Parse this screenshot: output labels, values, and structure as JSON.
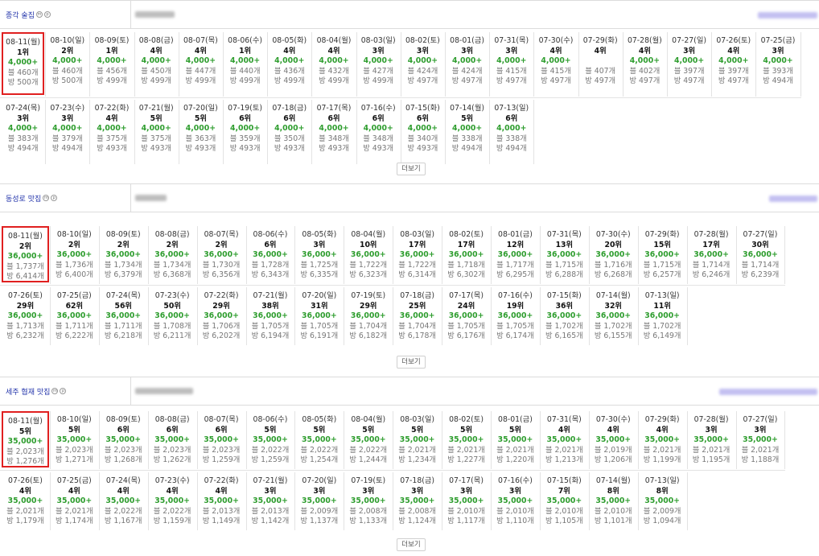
{
  "sections": [
    {
      "keyword": "종각 술집",
      "more_label": "더보기",
      "cols": 18,
      "cells": [
        {
          "d": "08-11(월)",
          "r": "1위",
          "g": "4,000+",
          "a": "블 460개",
          "b": "방 500개",
          "sel": true
        },
        {
          "d": "08-10(일)",
          "r": "2위",
          "g": "4,000+",
          "a": "블 460개",
          "b": "방 500개"
        },
        {
          "d": "08-09(토)",
          "r": "1위",
          "g": "4,000+",
          "a": "블 456개",
          "b": "방 499개"
        },
        {
          "d": "08-08(금)",
          "r": "4위",
          "g": "4,000+",
          "a": "블 450개",
          "b": "방 499개"
        },
        {
          "d": "08-07(목)",
          "r": "4위",
          "g": "4,000+",
          "a": "블 447개",
          "b": "방 499개"
        },
        {
          "d": "08-06(수)",
          "r": "1위",
          "g": "4,000+",
          "a": "블 440개",
          "b": "방 499개"
        },
        {
          "d": "08-05(화)",
          "r": "4위",
          "g": "4,000+",
          "a": "블 436개",
          "b": "방 499개"
        },
        {
          "d": "08-04(월)",
          "r": "4위",
          "g": "4,000+",
          "a": "블 432개",
          "b": "방 499개"
        },
        {
          "d": "08-03(일)",
          "r": "3위",
          "g": "4,000+",
          "a": "블 427개",
          "b": "방 499개"
        },
        {
          "d": "08-02(토)",
          "r": "3위",
          "g": "4,000+",
          "a": "블 424개",
          "b": "방 497개"
        },
        {
          "d": "08-01(금)",
          "r": "3위",
          "g": "4,000+",
          "a": "블 424개",
          "b": "방 497개"
        },
        {
          "d": "07-31(목)",
          "r": "3위",
          "g": "4,000+",
          "a": "블 415개",
          "b": "방 497개"
        },
        {
          "d": "07-30(수)",
          "r": "4위",
          "g": "4,000+",
          "a": "블 415개",
          "b": "방 497개"
        },
        {
          "d": "07-29(화)",
          "r": "4위",
          "g": "",
          "a": "블 407개",
          "b": "방 497개"
        },
        {
          "d": "07-28(월)",
          "r": "4위",
          "g": "4,000+",
          "a": "블 402개",
          "b": "방 497개"
        },
        {
          "d": "07-27(일)",
          "r": "3위",
          "g": "4,000+",
          "a": "블 397개",
          "b": "방 497개"
        },
        {
          "d": "07-26(토)",
          "r": "4위",
          "g": "4,000+",
          "a": "블 397개",
          "b": "방 497개"
        },
        {
          "d": "07-25(금)",
          "r": "3위",
          "g": "4,000+",
          "a": "블 393개",
          "b": "방 494개"
        },
        {
          "d": "07-24(목)",
          "r": "3위",
          "g": "4,000+",
          "a": "블 383개",
          "b": "방 494개"
        },
        {
          "d": "07-23(수)",
          "r": "3위",
          "g": "4,000+",
          "a": "블 379개",
          "b": "방 494개"
        },
        {
          "d": "07-22(화)",
          "r": "4위",
          "g": "4,000+",
          "a": "블 375개",
          "b": "방 493개"
        },
        {
          "d": "07-21(월)",
          "r": "5위",
          "g": "4,000+",
          "a": "블 375개",
          "b": "방 493개"
        },
        {
          "d": "07-20(일)",
          "r": "5위",
          "g": "4,000+",
          "a": "블 363개",
          "b": "방 493개"
        },
        {
          "d": "07-19(토)",
          "r": "6위",
          "g": "4,000+",
          "a": "블 359개",
          "b": "방 493개"
        },
        {
          "d": "07-18(금)",
          "r": "6위",
          "g": "4,000+",
          "a": "블 350개",
          "b": "방 493개"
        },
        {
          "d": "07-17(목)",
          "r": "6위",
          "g": "4,000+",
          "a": "블 348개",
          "b": "방 493개"
        },
        {
          "d": "07-16(수)",
          "r": "6위",
          "g": "4,000+",
          "a": "블 348개",
          "b": "방 493개"
        },
        {
          "d": "07-15(화)",
          "r": "6위",
          "g": "4,000+",
          "a": "블 340개",
          "b": "방 493개"
        },
        {
          "d": "07-14(월)",
          "r": "5위",
          "g": "4,000+",
          "a": "블 338개",
          "b": "방 494개"
        },
        {
          "d": "07-13(일)",
          "r": "6위",
          "g": "4,000+",
          "a": "블 338개",
          "b": "방 494개"
        }
      ]
    },
    {
      "keyword": "동성로 맛집",
      "more_label": "더보기",
      "cols": 16,
      "cells": [
        {
          "d": "08-11(월)",
          "r": "2위",
          "g": "36,000+",
          "a": "블 1,737개",
          "b": "방 6,414개",
          "sel": true
        },
        {
          "d": "08-10(일)",
          "r": "2위",
          "g": "36,000+",
          "a": "블 1,736개",
          "b": "방 6,400개"
        },
        {
          "d": "08-09(토)",
          "r": "2위",
          "g": "36,000+",
          "a": "블 1,734개",
          "b": "방 6,379개"
        },
        {
          "d": "08-08(금)",
          "r": "2위",
          "g": "36,000+",
          "a": "블 1,734개",
          "b": "방 6,368개"
        },
        {
          "d": "08-07(목)",
          "r": "2위",
          "g": "36,000+",
          "a": "블 1,730개",
          "b": "방 6,356개"
        },
        {
          "d": "08-06(수)",
          "r": "6위",
          "g": "36,000+",
          "a": "블 1,728개",
          "b": "방 6,343개"
        },
        {
          "d": "08-05(화)",
          "r": "3위",
          "g": "36,000+",
          "a": "블 1,725개",
          "b": "방 6,335개"
        },
        {
          "d": "08-04(월)",
          "r": "10위",
          "g": "36,000+",
          "a": "블 1,722개",
          "b": "방 6,323개"
        },
        {
          "d": "08-03(일)",
          "r": "17위",
          "g": "36,000+",
          "a": "블 1,722개",
          "b": "방 6,314개"
        },
        {
          "d": "08-02(토)",
          "r": "17위",
          "g": "36,000+",
          "a": "블 1,718개",
          "b": "방 6,302개"
        },
        {
          "d": "08-01(금)",
          "r": "12위",
          "g": "36,000+",
          "a": "블 1,717개",
          "b": "방 6,295개"
        },
        {
          "d": "07-31(목)",
          "r": "13위",
          "g": "36,000+",
          "a": "블 1,715개",
          "b": "방 6,288개"
        },
        {
          "d": "07-30(수)",
          "r": "20위",
          "g": "36,000+",
          "a": "블 1,716개",
          "b": "방 6,268개"
        },
        {
          "d": "07-29(화)",
          "r": "15위",
          "g": "36,000+",
          "a": "블 1,715개",
          "b": "방 6,257개"
        },
        {
          "d": "07-28(월)",
          "r": "17위",
          "g": "36,000+",
          "a": "블 1,714개",
          "b": "방 6,246개"
        },
        {
          "d": "07-27(일)",
          "r": "30위",
          "g": "36,000+",
          "a": "블 1,714개",
          "b": "방 6,239개"
        },
        {
          "d": "07-26(토)",
          "r": "29위",
          "g": "36,000+",
          "a": "블 1,713개",
          "b": "방 6,232개"
        },
        {
          "d": "07-25(금)",
          "r": "62위",
          "g": "36,000+",
          "a": "블 1,711개",
          "b": "방 6,222개"
        },
        {
          "d": "07-24(목)",
          "r": "56위",
          "g": "36,000+",
          "a": "블 1,711개",
          "b": "방 6,218개"
        },
        {
          "d": "07-23(수)",
          "r": "50위",
          "g": "36,000+",
          "a": "블 1,708개",
          "b": "방 6,211개"
        },
        {
          "d": "07-22(화)",
          "r": "29위",
          "g": "36,000+",
          "a": "블 1,706개",
          "b": "방 6,202개"
        },
        {
          "d": "07-21(월)",
          "r": "38위",
          "g": "36,000+",
          "a": "블 1,705개",
          "b": "방 6,194개"
        },
        {
          "d": "07-20(일)",
          "r": "31위",
          "g": "36,000+",
          "a": "블 1,705개",
          "b": "방 6,191개"
        },
        {
          "d": "07-19(토)",
          "r": "29위",
          "g": "36,000+",
          "a": "블 1,704개",
          "b": "방 6,182개"
        },
        {
          "d": "07-18(금)",
          "r": "25위",
          "g": "36,000+",
          "a": "블 1,704개",
          "b": "방 6,178개"
        },
        {
          "d": "07-17(목)",
          "r": "24위",
          "g": "36,000+",
          "a": "블 1,705개",
          "b": "방 6,176개"
        },
        {
          "d": "07-16(수)",
          "r": "19위",
          "g": "36,000+",
          "a": "블 1,705개",
          "b": "방 6,174개"
        },
        {
          "d": "07-15(화)",
          "r": "36위",
          "g": "36,000+",
          "a": "블 1,702개",
          "b": "방 6,165개"
        },
        {
          "d": "07-14(월)",
          "r": "32위",
          "g": "36,000+",
          "a": "블 1,702개",
          "b": "방 6,155개"
        },
        {
          "d": "07-13(일)",
          "r": "11위",
          "g": "36,000+",
          "a": "블 1,702개",
          "b": "방 6,149개"
        }
      ]
    },
    {
      "keyword": "세주 협재 맛집",
      "more_label": "더보기",
      "cols": 16,
      "cells": [
        {
          "d": "08-11(월)",
          "r": "5위",
          "g": "35,000+",
          "a": "블 2,023개",
          "b": "방 1,276개",
          "sel": true
        },
        {
          "d": "08-10(일)",
          "r": "5위",
          "g": "35,000+",
          "a": "블 2,023개",
          "b": "방 1,271개"
        },
        {
          "d": "08-09(토)",
          "r": "6위",
          "g": "35,000+",
          "a": "블 2,023개",
          "b": "방 1,268개"
        },
        {
          "d": "08-08(금)",
          "r": "6위",
          "g": "35,000+",
          "a": "블 2,023개",
          "b": "방 1,262개"
        },
        {
          "d": "08-07(목)",
          "r": "6위",
          "g": "35,000+",
          "a": "블 2,023개",
          "b": "방 1,259개"
        },
        {
          "d": "08-06(수)",
          "r": "5위",
          "g": "35,000+",
          "a": "블 2,022개",
          "b": "방 1,259개"
        },
        {
          "d": "08-05(화)",
          "r": "5위",
          "g": "35,000+",
          "a": "블 2,022개",
          "b": "방 1,254개"
        },
        {
          "d": "08-04(월)",
          "r": "5위",
          "g": "35,000+",
          "a": "블 2,022개",
          "b": "방 1,244개"
        },
        {
          "d": "08-03(일)",
          "r": "5위",
          "g": "35,000+",
          "a": "블 2,021개",
          "b": "방 1,234개"
        },
        {
          "d": "08-02(토)",
          "r": "5위",
          "g": "35,000+",
          "a": "블 2,021개",
          "b": "방 1,227개"
        },
        {
          "d": "08-01(금)",
          "r": "5위",
          "g": "35,000+",
          "a": "블 2,021개",
          "b": "방 1,220개"
        },
        {
          "d": "07-31(목)",
          "r": "4위",
          "g": "35,000+",
          "a": "블 2,021개",
          "b": "방 1,213개"
        },
        {
          "d": "07-30(수)",
          "r": "4위",
          "g": "35,000+",
          "a": "블 2,019개",
          "b": "방 1,206개"
        },
        {
          "d": "07-29(화)",
          "r": "4위",
          "g": "35,000+",
          "a": "블 2,021개",
          "b": "방 1,199개"
        },
        {
          "d": "07-28(월)",
          "r": "3위",
          "g": "35,000+",
          "a": "블 2,021개",
          "b": "방 1,195개"
        },
        {
          "d": "07-27(일)",
          "r": "3위",
          "g": "35,000+",
          "a": "블 2,021개",
          "b": "방 1,188개"
        },
        {
          "d": "07-26(토)",
          "r": "4위",
          "g": "35,000+",
          "a": "블 2,021개",
          "b": "방 1,179개"
        },
        {
          "d": "07-25(금)",
          "r": "4위",
          "g": "35,000+",
          "a": "블 2,021개",
          "b": "방 1,174개"
        },
        {
          "d": "07-24(목)",
          "r": "4위",
          "g": "35,000+",
          "a": "블 2,022개",
          "b": "방 1,167개"
        },
        {
          "d": "07-23(수)",
          "r": "4위",
          "g": "35,000+",
          "a": "블 2,022개",
          "b": "방 1,159개"
        },
        {
          "d": "07-22(화)",
          "r": "4위",
          "g": "35,000+",
          "a": "블 2,013개",
          "b": "방 1,149개"
        },
        {
          "d": "07-21(월)",
          "r": "3위",
          "g": "35,000+",
          "a": "블 2,013개",
          "b": "방 1,142개"
        },
        {
          "d": "07-20(일)",
          "r": "3위",
          "g": "35,000+",
          "a": "블 2,009개",
          "b": "방 1,137개"
        },
        {
          "d": "07-19(토)",
          "r": "3위",
          "g": "35,000+",
          "a": "블 2,008개",
          "b": "방 1,133개"
        },
        {
          "d": "07-18(금)",
          "r": "3위",
          "g": "35,000+",
          "a": "블 2,008개",
          "b": "방 1,124개"
        },
        {
          "d": "07-17(목)",
          "r": "3위",
          "g": "35,000+",
          "a": "블 2,010개",
          "b": "방 1,117개"
        },
        {
          "d": "07-16(수)",
          "r": "3위",
          "g": "35,000+",
          "a": "블 2,010개",
          "b": "방 1,110개"
        },
        {
          "d": "07-15(화)",
          "r": "7위",
          "g": "35,000+",
          "a": "블 2,010개",
          "b": "방 1,105개"
        },
        {
          "d": "07-14(월)",
          "r": "8위",
          "g": "35,000+",
          "a": "블 2,010개",
          "b": "방 1,101개"
        },
        {
          "d": "07-13(일)",
          "r": "8위",
          "g": "35,000+",
          "a": "블 2,009개",
          "b": "방 1,094개"
        }
      ]
    }
  ]
}
